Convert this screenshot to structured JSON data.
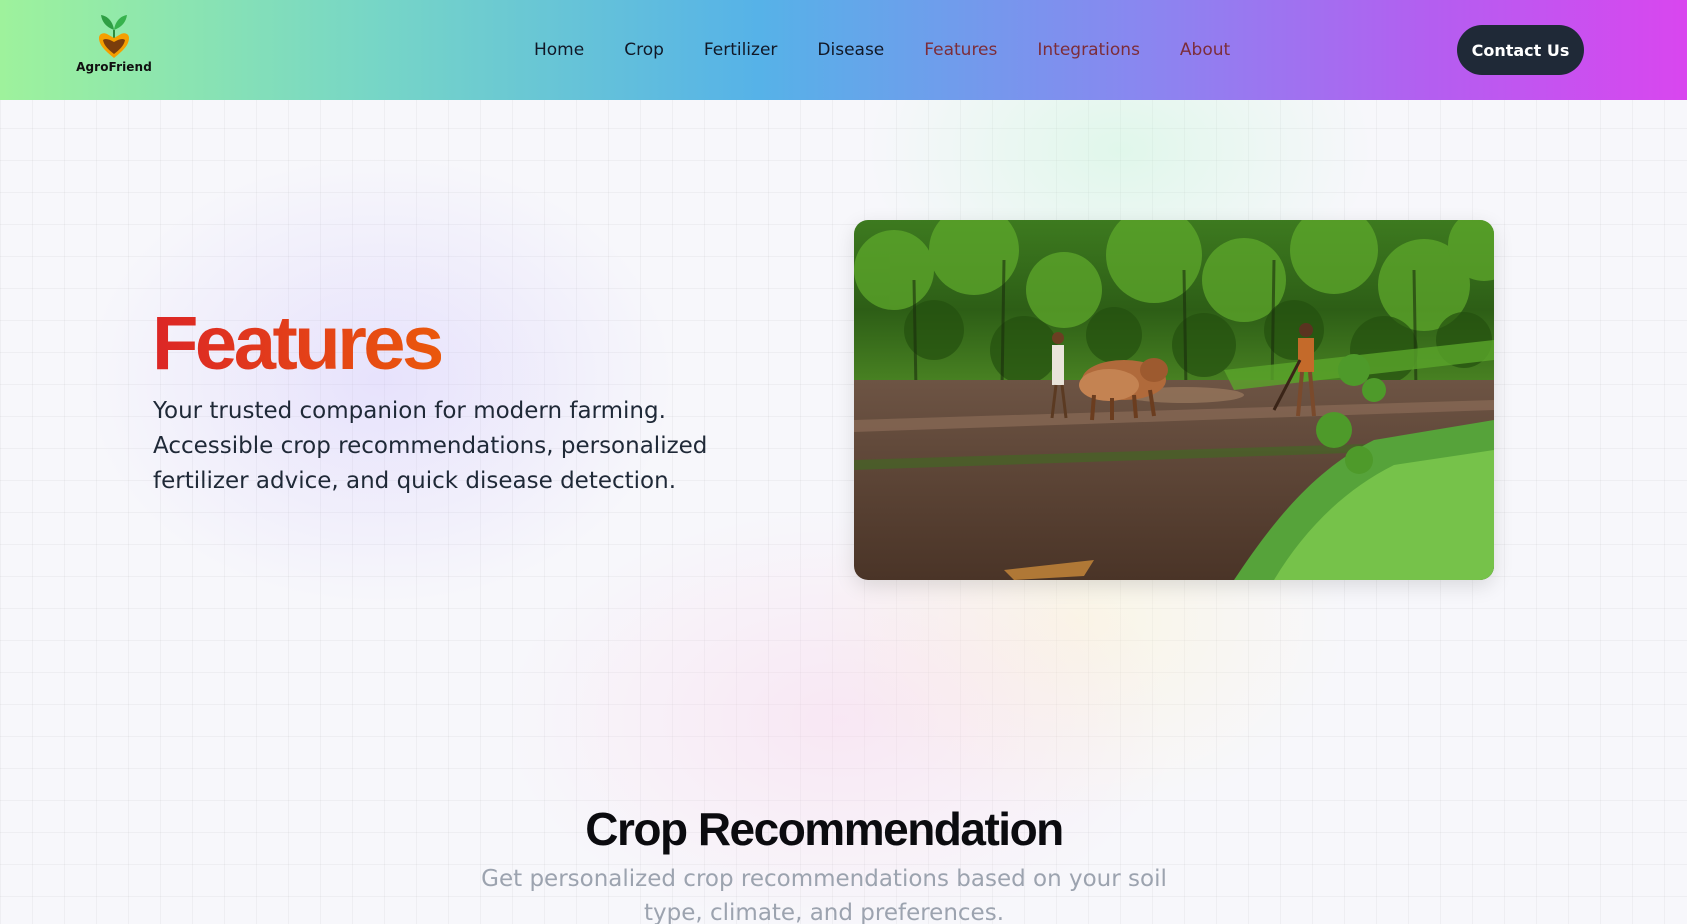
{
  "navbar": {
    "logo_text": "AgroFriend",
    "links": [
      "Home",
      "Crop",
      "Fertilizer",
      "Disease",
      "Features",
      "Integrations",
      "About"
    ],
    "contact_label": "Contact Us"
  },
  "hero": {
    "title": "Features",
    "description": "Your trusted companion for modern farming. Accessible crop recommendations, personalized fertilizer advice, and quick disease detection."
  },
  "section": {
    "title": "Crop Recommendation",
    "description": "Get personalized crop recommendations based on your soil type, climate, and preferences."
  },
  "colors": {
    "accent_red": "#dc2626",
    "button_dark": "#1f2937"
  }
}
